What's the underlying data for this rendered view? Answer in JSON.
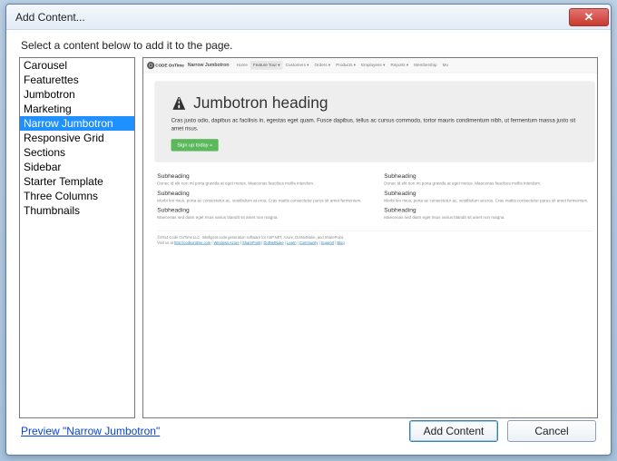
{
  "window": {
    "title": "Add Content...",
    "prompt": "Select a content below to add it to the page."
  },
  "list": {
    "items": [
      "Carousel",
      "Featurettes",
      "Jumbotron",
      "Marketing",
      "Narrow Jumbotron",
      "Responsive Grid",
      "Sections",
      "Sidebar",
      "Starter Template",
      "Three Columns",
      "Thumbnails"
    ],
    "selected_index": 4
  },
  "preview": {
    "logo_text": "CODE OnTime",
    "brand": "Narrow Jumbotron",
    "nav": [
      "Home",
      "Feature Tour",
      "Customers",
      "Orders",
      "Products",
      "Employees",
      "Reports",
      "Membership",
      "Mo"
    ],
    "nav_active_index": 1,
    "jumbo_heading": "Jumbotron heading",
    "jumbo_desc": "Cras justo odio, dapibus ac facilisis in, egestas eget quam. Fusce dapibus, tellus ac cursus commodo, tortor mauris condimentum nibh, ut fermentum massa justo sit amet risus.",
    "signup_label": "Sign up today »",
    "columns": [
      {
        "blocks": [
          {
            "sh": "Subheading",
            "sd": "Donec id elit non mi porta gravida at eget metus. Maecenas faucibus mollis interdum."
          },
          {
            "sh": "Subheading",
            "sd": "Morbi leo risus, porta ac consectetur ac, vestibulum at eros. Cras mattis consectetur purus sit amet fermentum."
          },
          {
            "sh": "Subheading",
            "sd": "Maecenas sed diam eget risus varius blandit sit amet non magna."
          }
        ]
      },
      {
        "blocks": [
          {
            "sh": "Subheading",
            "sd": "Donec id elit non mi porta gravida at eget metus. Maecenas faucibus mollis interdum."
          },
          {
            "sh": "Subheading",
            "sd": "Morbi leo risus, porta ac consectetur ac, vestibulum at eros. Cras mattis consectetur purus sit amet fermentum."
          },
          {
            "sh": "Subheading",
            "sd": "Maecenas sed diam eget risus varius blandit sit amet non magna."
          }
        ]
      }
    ],
    "footer_line1": "©2014 Code OnTime LLC. Intelligent code generation software for ASP.NET, Azure, DotNetNuke, and SharePoint.",
    "footer_line2_prefix": "Visit us at ",
    "footer_links": [
      "http://codeontime.com",
      "Windows Azure",
      "SharePoint",
      "DotNetNuke",
      "Learn",
      "Community",
      "Support",
      "Blog"
    ]
  },
  "bottom": {
    "preview_link": "Preview \"Narrow Jumbotron\"",
    "add_button": "Add Content",
    "cancel_button": "Cancel"
  }
}
